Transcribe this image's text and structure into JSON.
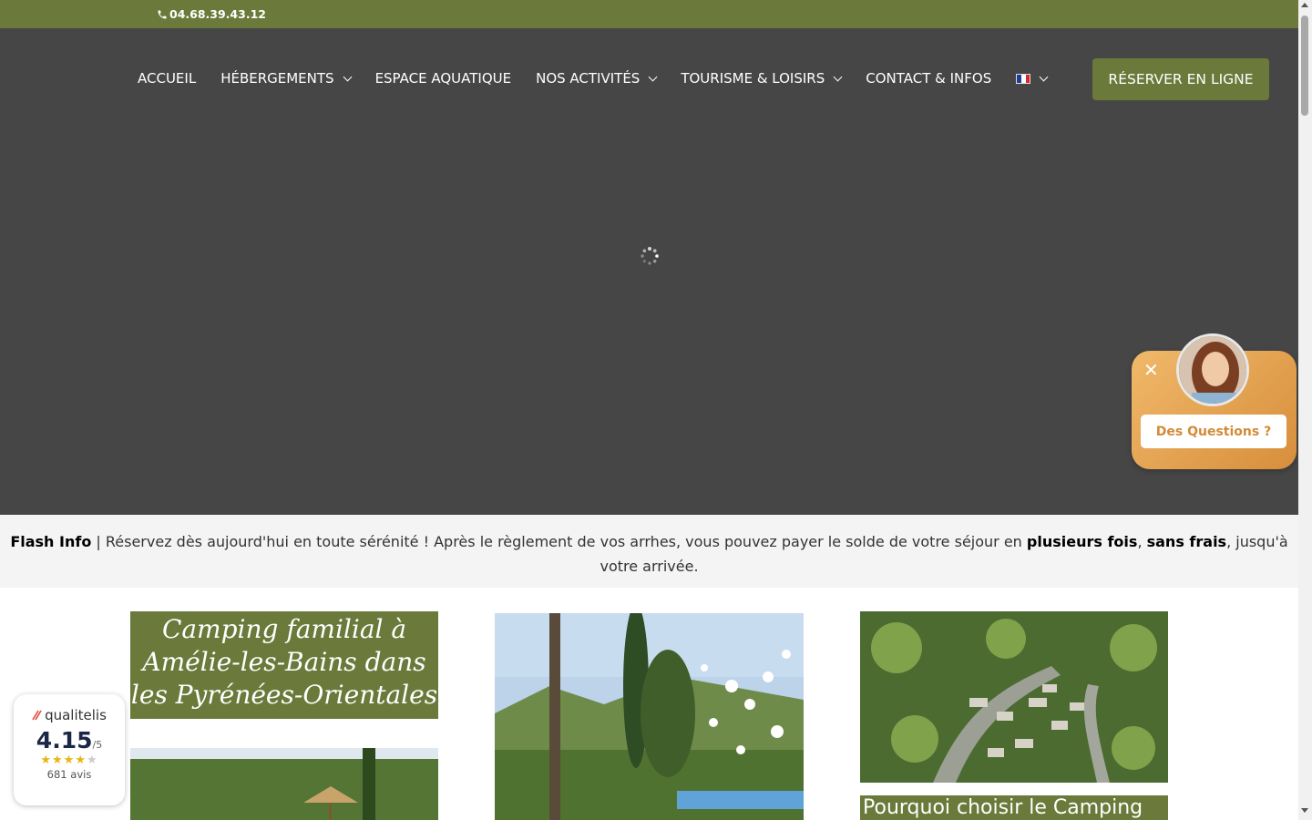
{
  "topbar": {
    "phone": "04.68.39.43.12",
    "phone_icon": "phone-icon"
  },
  "nav": {
    "items": [
      {
        "label": "ACCUEIL",
        "has_dropdown": false
      },
      {
        "label": "HÉBERGEMENTS",
        "has_dropdown": true
      },
      {
        "label": "ESPACE AQUATIQUE",
        "has_dropdown": false
      },
      {
        "label": "NOS ACTIVITÉS",
        "has_dropdown": true
      },
      {
        "label": "TOURISME & LOISIRS",
        "has_dropdown": true
      },
      {
        "label": "CONTACT & INFOS",
        "has_dropdown": false
      }
    ],
    "language_icon": "flag-fr-icon",
    "reserve_label": "RÉSERVER EN LIGNE"
  },
  "flash": {
    "title": "Flash Info",
    "text_1": " | Réservez dès aujourd'hui en toute sérénité ! Après le règlement de vos arrhes, vous pouvez payer le solde de votre séjour en ",
    "bold_1": "plusieurs fois",
    "sep": ", ",
    "bold_2": "sans frais",
    "text_2": ", jusqu'à votre arrivée."
  },
  "content": {
    "card1_title": "Camping familial à Amélie-les-Bains dans les Pyrénées-Orientales",
    "card3_title": "Pourquoi choisir le Camping"
  },
  "qualitelis": {
    "brand": "qualitelis",
    "score": "4.15",
    "scale": "/5",
    "rating": 4,
    "reviews": "681 avis"
  },
  "chat": {
    "button": "Des Questions ?",
    "close": "✕"
  },
  "colors": {
    "accent": "#6b7a3a",
    "header_bg": "#464646",
    "chat": "#e3a24f"
  }
}
